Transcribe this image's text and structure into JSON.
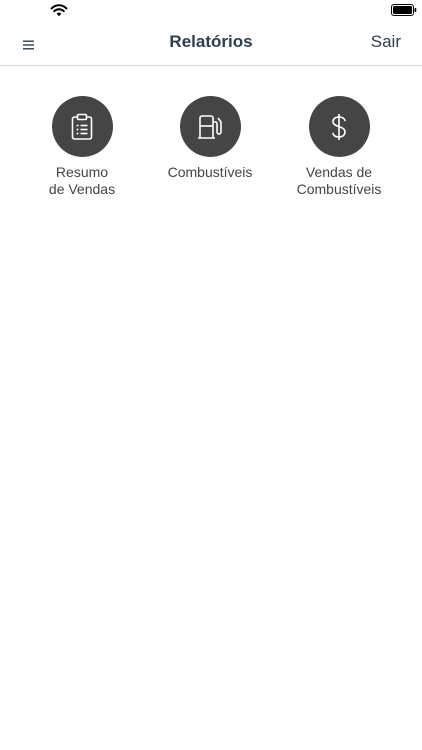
{
  "status_bar": {
    "wifi_icon": "wifi-icon",
    "battery_icon": "battery-full-icon"
  },
  "nav": {
    "menu_icon": "hamburger-menu-icon",
    "title": "Relatórios",
    "logout_label": "Sair"
  },
  "reports": [
    {
      "label": "Resumo\nde Vendas",
      "icon": "clipboard-list-icon"
    },
    {
      "label": "Combustíveis",
      "icon": "fuel-pump-icon"
    },
    {
      "label": "Vendas de\nCombustíveis",
      "icon": "dollar-sign-icon"
    }
  ],
  "colors": {
    "icon_circle": "#454545",
    "title_text": "#2c3e50",
    "label_text": "#444444",
    "divider": "#d9d9d9"
  }
}
